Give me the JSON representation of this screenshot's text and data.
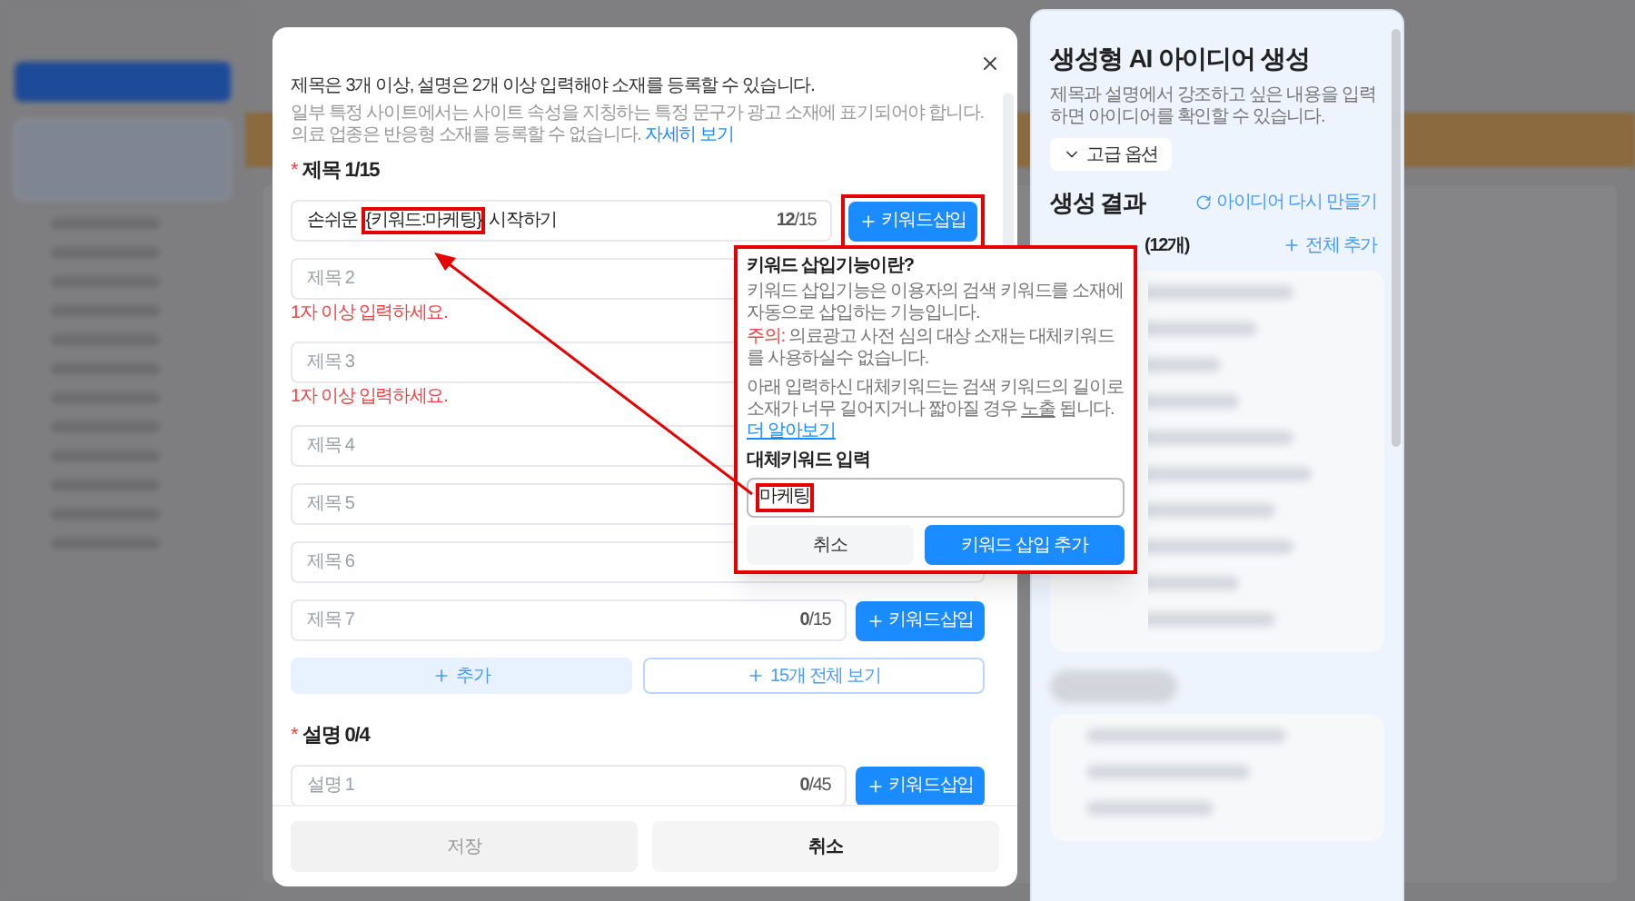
{
  "modal": {
    "notice": "제목은 3개 이상, 설명은 2개 이상 입력해야 소재를 등록할 수 있습니다.",
    "info": [
      "일부 특정 사이트에서는 사이트 속성을 지칭하는 특정 문구가 광고 소재에 표기되어야 합니다.",
      "의료 업종은 반응형 소재를 등록할 수 없습니다."
    ],
    "info_link": "자세히 보기",
    "titles": {
      "required_mark": "*",
      "heading": "제목 **1**/15",
      "rows": [
        {
          "value_parts": [
            {
              "text": "손쉬운 ",
              "highlighted": false
            },
            {
              "text": "{키워드:마케팅}",
              "highlighted": true
            },
            {
              "text": " 시작하기",
              "highlighted": false
            }
          ],
          "count": "**12**/15",
          "button": "키워드삽입",
          "highlighted": true
        },
        {
          "placeholder": "제목 2",
          "error": "1자 이상 입력하세요."
        },
        {
          "placeholder": "제목 3",
          "error": "1자 이상 입력하세요."
        },
        {
          "placeholder": "제목 4"
        },
        {
          "placeholder": "제목 5"
        },
        {
          "placeholder": "제목 6"
        },
        {
          "placeholder": "제목 7",
          "count": "**0**/15",
          "button": "키워드삽입",
          "highlighted": false
        }
      ],
      "add_button": "추가",
      "view_all_button": "15개 전체 보기"
    },
    "descriptions": {
      "required_mark": "*",
      "heading": "설명 **0**/4",
      "rows": [
        {
          "placeholder": "설명 1",
          "count": "**0**/45",
          "button": "키워드삽입",
          "highlighted": false
        }
      ]
    },
    "footer": {
      "save": "저장",
      "save_disabled": true,
      "cancel": "취소"
    }
  },
  "popover": {
    "highlighted": true,
    "title": "키워드 삽입기능이란?",
    "description": "키워드 삽입기능은 이용자의 검색 키워드를 소재에 자동으로 삽입하는 기능입니다.",
    "warning_label": "주의:",
    "warning": " 의료광고 사전 심의 대상 소재는 대체키워드를 사용하실수 없습니다.",
    "note_before": "아래 입력하신 대체키워드는 검색 키워드의 길이로 소재가 너무 길어지거나 짧아질 경우 ",
    "note_underlined": "노출",
    "note_after": " 됩니다.",
    "link": "더 알아보기",
    "input_label": "대체키워드 입력",
    "input_value": "마케팅",
    "input_highlighted": true,
    "cancel": "취소",
    "confirm": "키워드 삽입 추가"
  },
  "ai_panel": {
    "title": "생성형 AI 아이디어 생성",
    "description": "제목과 설명에서 강조하고 싶은 내용을 입력하면 아이디어를 확인할 수 있습니다.",
    "advanced_button": "고급 옵션",
    "results_title": "생성 결과",
    "regenerate": "아이디어 다시 만들기",
    "ideas_count": "(12개)",
    "add_all": "전체 추가"
  }
}
